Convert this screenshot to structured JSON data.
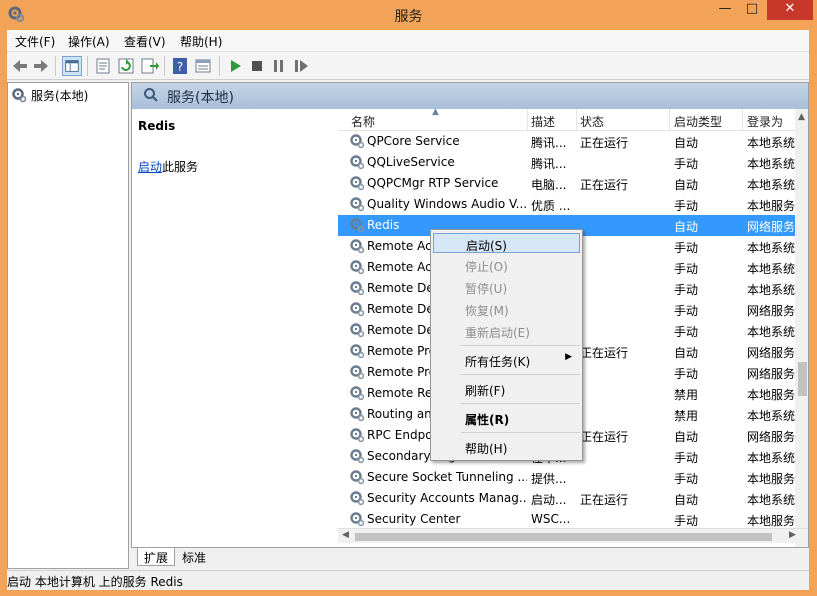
{
  "window": {
    "title": "服务",
    "min_glyph": "—",
    "max_glyph": "□",
    "close_glyph": "✕"
  },
  "menubar": {
    "items": [
      "文件(F)",
      "操作(A)",
      "查看(V)",
      "帮助(H)"
    ]
  },
  "toolbar": {
    "buttons": [
      "back-icon",
      "forward-icon",
      "show-console-tree-icon",
      "properties-icon",
      "refresh-icon",
      "export-list-icon",
      "help-icon",
      "details-view-icon",
      "start-icon",
      "stop-icon",
      "pause-icon",
      "restart-icon"
    ]
  },
  "tree": {
    "root_label": "服务(本地)"
  },
  "pane": {
    "header": "服务(本地)",
    "selected_name": "Redis",
    "action_link": "启动",
    "action_suffix": "此服务"
  },
  "columns": {
    "name": "名称",
    "desc": "描述",
    "state": "状态",
    "start_type": "启动类型",
    "logon": "登录为"
  },
  "rows": [
    {
      "name": "QPCore Service",
      "desc": "腾讯...",
      "state": "正在运行",
      "start": "自动",
      "logon": "本地系统"
    },
    {
      "name": "QQLiveService",
      "desc": "腾讯...",
      "state": "",
      "start": "手动",
      "logon": "本地系统"
    },
    {
      "name": "QQPCMgr RTP Service",
      "desc": "电脑...",
      "state": "正在运行",
      "start": "自动",
      "logon": "本地系统"
    },
    {
      "name": "Quality Windows Audio V...",
      "desc": "优质 ...",
      "state": "",
      "start": "手动",
      "logon": "本地服务"
    },
    {
      "name": "Redis",
      "desc": "",
      "state": "",
      "start": "自动",
      "logon": "网络服务"
    },
    {
      "name": "Remote Ac",
      "desc": "",
      "state": "",
      "start": "手动",
      "logon": "本地系统"
    },
    {
      "name": "Remote Ac",
      "desc": "",
      "state": "",
      "start": "手动",
      "logon": "本地系统"
    },
    {
      "name": "Remote De",
      "desc": "",
      "state": "",
      "start": "手动",
      "logon": "本地系统"
    },
    {
      "name": "Remote De",
      "desc": "",
      "state": "",
      "start": "手动",
      "logon": "网络服务"
    },
    {
      "name": "Remote De",
      "desc": "",
      "state": "",
      "start": "手动",
      "logon": "本地系统"
    },
    {
      "name": "Remote Pro",
      "desc": "",
      "state": "正在运行",
      "start": "自动",
      "logon": "网络服务"
    },
    {
      "name": "Remote Pro",
      "desc": "",
      "state": "",
      "start": "手动",
      "logon": "网络服务"
    },
    {
      "name": "Remote Re",
      "desc": "",
      "state": "",
      "start": "禁用",
      "logon": "本地服务"
    },
    {
      "name": "Routing an",
      "desc": "",
      "state": "",
      "start": "禁用",
      "logon": "本地系统"
    },
    {
      "name": "RPC Endpo",
      "desc": "",
      "state": "正在运行",
      "start": "自动",
      "logon": "网络服务"
    },
    {
      "name": "Secondary Logon",
      "desc": "在不...",
      "state": "",
      "start": "手动",
      "logon": "本地系统"
    },
    {
      "name": "Secure Socket Tunneling ...",
      "desc": "提供...",
      "state": "",
      "start": "手动",
      "logon": "本地服务"
    },
    {
      "name": "Security Accounts Manag...",
      "desc": "启动...",
      "state": "正在运行",
      "start": "自动",
      "logon": "本地系统"
    },
    {
      "name": "Security Center",
      "desc": "WSC...",
      "state": "",
      "start": "手动",
      "logon": "本地服务"
    }
  ],
  "context_menu": {
    "start": "启动(S)",
    "stop": "停止(O)",
    "pause": "暂停(U)",
    "resume": "恢复(M)",
    "restart": "重新启动(E)",
    "all_tasks": "所有任务(K)",
    "refresh": "刷新(F)",
    "properties": "属性(R)",
    "help": "帮助(H)"
  },
  "tabs": [
    "扩展",
    "标准"
  ],
  "status": "启动 本地计算机 上的服务 Redis",
  "colors": {
    "title_bg": "#f2a357",
    "selection": "#3399ff",
    "header_band": "#b4c8de",
    "link": "#0046c8",
    "close_btn": "#c7372a"
  }
}
